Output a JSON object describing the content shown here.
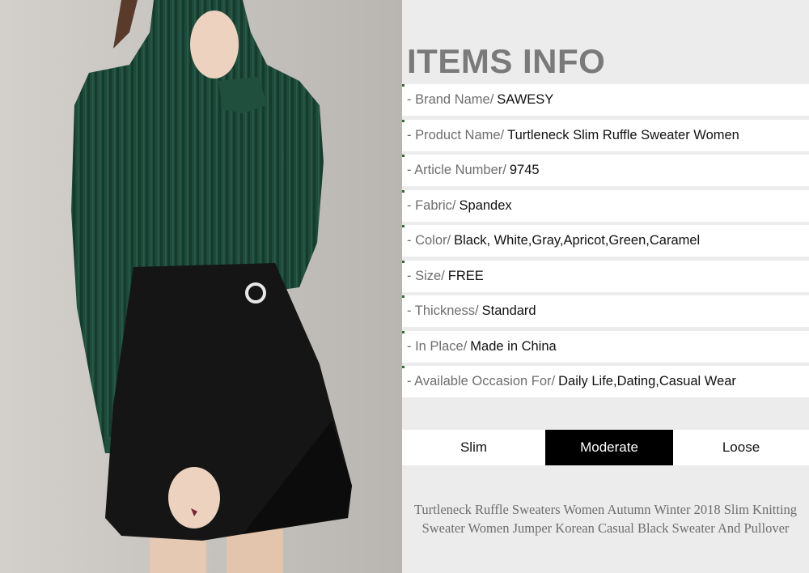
{
  "title": "ITEMS INFO",
  "rows": [
    {
      "label": "- Brand Name/",
      "value": "SAWESY"
    },
    {
      "label": "- Product Name/",
      "value": "Turtleneck Slim Ruffle Sweater Women"
    },
    {
      "label": "- Article Number/",
      "value": "9745"
    },
    {
      "label": "- Fabric/",
      "value": "Spandex"
    },
    {
      "label": "- Color/",
      "value": "Black, White,Gray,Apricot,Green,Caramel"
    },
    {
      "label": "- Size/",
      "value": "FREE"
    },
    {
      "label": "- Thickness/",
      "value": "Standard"
    },
    {
      "label": "- In Place/",
      "value": "Made in China"
    },
    {
      "label": "- Available Occasion For/",
      "value": "Daily Life,Dating,Casual Wear"
    }
  ],
  "fit": {
    "options": [
      "Slim",
      "Moderate",
      "Loose"
    ],
    "selected": "Moderate"
  },
  "description": {
    "line1": "Turtleneck Ruffle Sweaters Women Autumn Winter 2018 Slim Knitting",
    "line2": "Sweater Women Jumper Korean Casual Black Sweater And Pullover"
  },
  "colors": {
    "sweater": "#1d4a3a",
    "skirt": "#141414",
    "label_gray": "#6e6e6e",
    "title_gray": "#7a7a7a",
    "selected_bg": "#000000"
  }
}
